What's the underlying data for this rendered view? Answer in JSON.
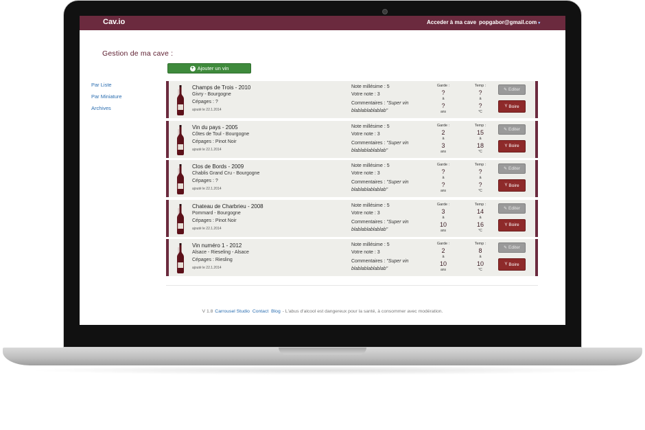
{
  "header": {
    "brand": "Cav.io",
    "nav_cave": "Acceder à ma cave",
    "user_email": "popgabor@gmail.com",
    "caret": "▾"
  },
  "page": {
    "title": "Gestion de ma cave :",
    "add_button": "Ajouter un vin"
  },
  "sidebar": {
    "items": [
      {
        "label": "Par Liste"
      },
      {
        "label": "Par Miniature"
      },
      {
        "label": "Archives"
      }
    ]
  },
  "labels": {
    "garde": "Garde :",
    "temp": "Temp :",
    "a": "à",
    "ans": "ans",
    "celsius": "°C",
    "edit": "Editer",
    "drink": "Boire"
  },
  "wines": [
    {
      "name": "Champs de Trois - 2010",
      "region": "Givry - Bourgogne",
      "cepages": "Cépages : ?",
      "added": "ajouté le 22.1.2014",
      "note_millesime": "Note millésime : 5",
      "note_vous": "Votre note : 3",
      "commentaires_label": "Commentaires : ",
      "commentaire": "\"Super vin blablablablablab\"",
      "garde_min": "?",
      "garde_max": "?",
      "temp_min": "?",
      "temp_max": "?"
    },
    {
      "name": "Vin du pays - 2005",
      "region": "Côtes de Toul - Bourgogne",
      "cepages": "Cépages : Pinot Noir",
      "added": "ajouté le 22.1.2014",
      "note_millesime": "Note millésime : 5",
      "note_vous": "Votre note : 3",
      "commentaires_label": "Commentaires : ",
      "commentaire": "\"Super vin blablablablablab\"",
      "garde_min": "2",
      "garde_max": "3",
      "temp_min": "15",
      "temp_max": "18"
    },
    {
      "name": "Clos de Bords - 2009",
      "region": "Chablis Grand Cru - Bourgogne",
      "cepages": "Cépages : ?",
      "added": "ajouté le 22.1.2014",
      "note_millesime": "Note millésime : 5",
      "note_vous": "Votre note : 3",
      "commentaires_label": "Commentaires : ",
      "commentaire": "\"Super vin blablablablablab\"",
      "garde_min": "?",
      "garde_max": "?",
      "temp_min": "?",
      "temp_max": "?"
    },
    {
      "name": "Chateau de Charbrieu - 2008",
      "region": "Pommard - Bourgogne",
      "cepages": "Cépages : Pinot Noir",
      "added": "ajouté le 22.1.2014",
      "note_millesime": "Note millésime : 5",
      "note_vous": "Votre note : 3",
      "commentaires_label": "Commentaires : ",
      "commentaire": "\"Super vin blablablablablab\"",
      "garde_min": "3",
      "garde_max": "10",
      "temp_min": "14",
      "temp_max": "16"
    },
    {
      "name": "Vin numéro 1 - 2012",
      "region": "Alsace - Rieseling - Alsace",
      "cepages": "Cépages : Riesling",
      "added": "ajouté le 22.1.2014",
      "note_millesime": "Note millésime : 5",
      "note_vous": "Votre note : 3",
      "commentaires_label": "Commentaires : ",
      "commentaire": "\"Super vin blablablablablab\"",
      "garde_min": "2",
      "garde_max": "10",
      "temp_min": "8",
      "temp_max": "10"
    }
  ],
  "footer": {
    "version": "V 1.8",
    "link_studio": "Carrousel Studio",
    "link_contact": "Contact",
    "link_blog": "Blog",
    "disclaimer": " - L'abus d'alcool est dangereux pour la santé, à consommer avec modération."
  },
  "colors": {
    "brand": "#6b2a3e",
    "add_button": "#3f8a3c",
    "drink_button": "#8e2a2a",
    "edit_button": "#9a9a9a",
    "link": "#2a6db0"
  }
}
